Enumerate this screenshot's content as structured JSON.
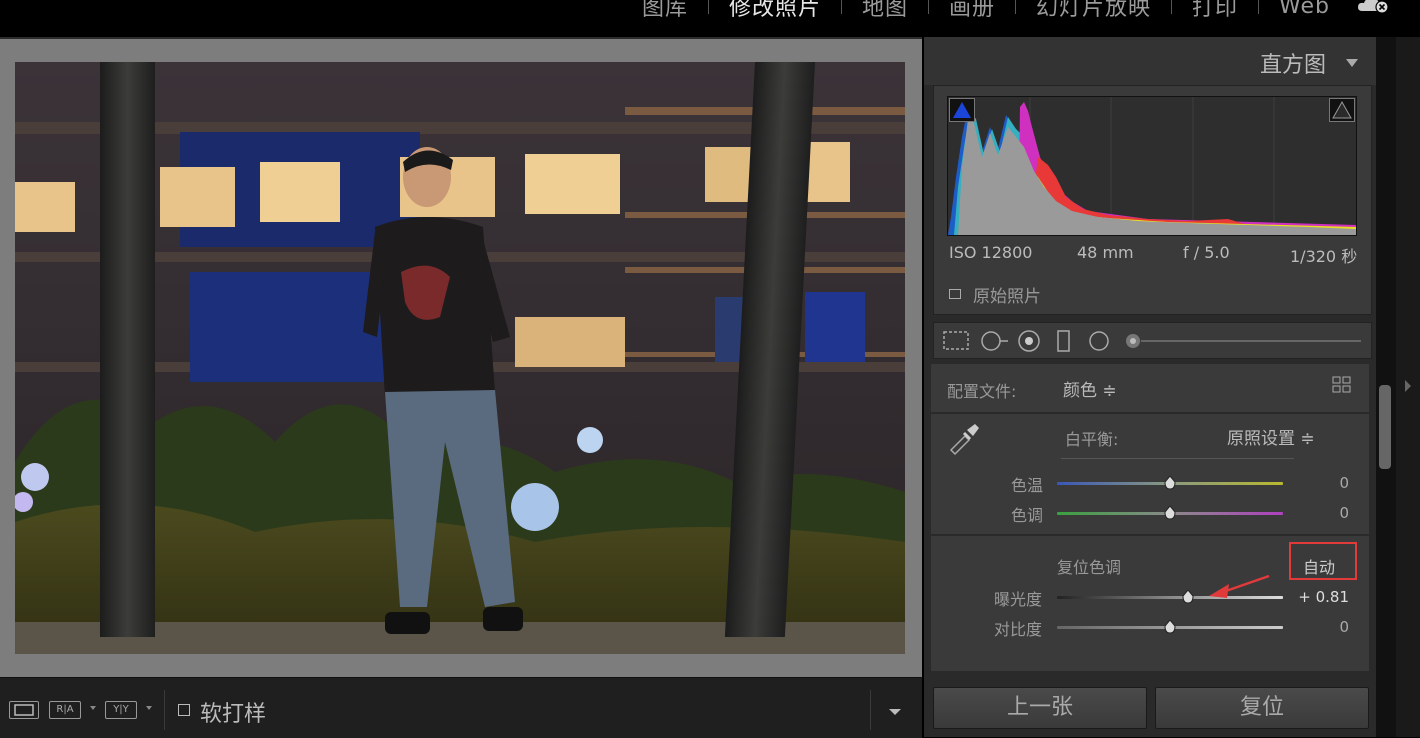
{
  "modules": [
    {
      "label": "图库",
      "active": false
    },
    {
      "label": "修改照片",
      "active": true
    },
    {
      "label": "地图",
      "active": false
    },
    {
      "label": "画册",
      "active": false
    },
    {
      "label": "幻灯片放映",
      "active": false
    },
    {
      "label": "打印",
      "active": false
    },
    {
      "label": "Web",
      "active": false
    }
  ],
  "histogram": {
    "title": "直方图",
    "iso": "ISO 12800",
    "focal": "48 mm",
    "aperture": "f / 5.0",
    "shutter": "1/320 秒",
    "original_photo_label": "原始照片"
  },
  "basic": {
    "profile_label": "配置文件:",
    "profile_value": "颜色 ≑",
    "wb_label": "白平衡:",
    "wb_value": "原照设置 ≑",
    "temp_label": "色温",
    "temp_value": "0",
    "tint_label": "色调",
    "tint_value": "0",
    "tone_label": "复位色调",
    "auto_label": "自动",
    "exposure_label": "曝光度",
    "exposure_value": "+ 0.81",
    "contrast_label": "对比度",
    "contrast_value": "0"
  },
  "slider_levels": {
    "temp": 0.5,
    "tint": 0.5,
    "exposure": 0.581,
    "contrast": 0.5
  },
  "bottom_toolbar": {
    "view_ra": "R|A",
    "view_yy": "Y|Y",
    "softproof_label": "软打样"
  },
  "nav": {
    "prev_label": "上一张",
    "reset_label": "复位"
  },
  "colors": {
    "accent_red": "#e03a3a",
    "panel_bg": "#3a3a3a"
  }
}
